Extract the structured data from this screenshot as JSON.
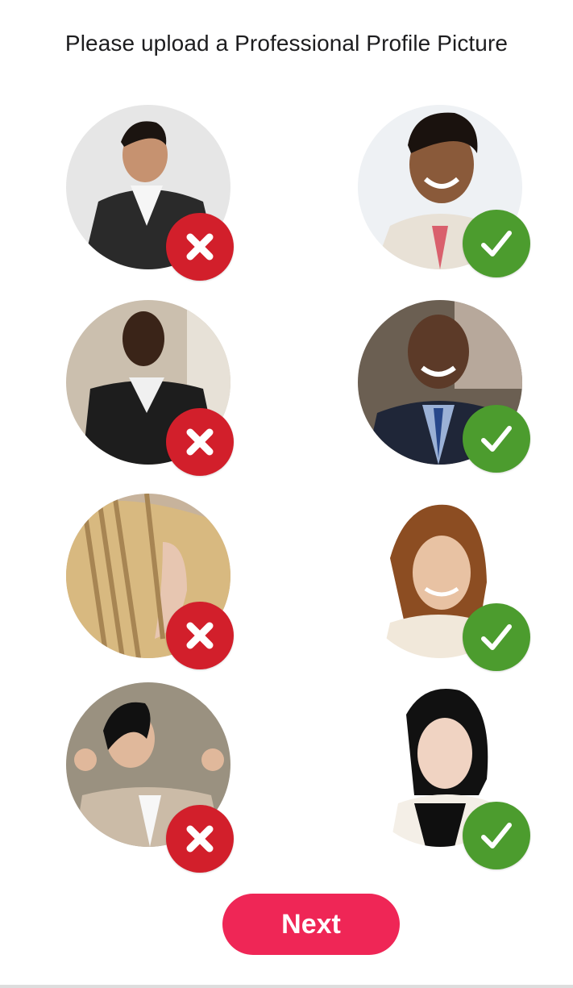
{
  "title": "Please upload a Professional Profile Picture",
  "next_label": "Next",
  "colors": {
    "accent": "#ef2656",
    "rejected": "#d21f2b",
    "approved": "#4c9c2e"
  },
  "examples": [
    {
      "row": 1,
      "side": "left",
      "status": "rejected",
      "icon": "x-icon"
    },
    {
      "row": 1,
      "side": "right",
      "status": "approved",
      "icon": "check-icon"
    },
    {
      "row": 2,
      "side": "left",
      "status": "rejected",
      "icon": "x-icon"
    },
    {
      "row": 2,
      "side": "right",
      "status": "approved",
      "icon": "check-icon"
    },
    {
      "row": 3,
      "side": "left",
      "status": "rejected",
      "icon": "x-icon"
    },
    {
      "row": 3,
      "side": "right",
      "status": "approved",
      "icon": "check-icon"
    },
    {
      "row": 4,
      "side": "left",
      "status": "rejected",
      "icon": "x-icon"
    },
    {
      "row": 4,
      "side": "right",
      "status": "approved",
      "icon": "check-icon"
    }
  ]
}
